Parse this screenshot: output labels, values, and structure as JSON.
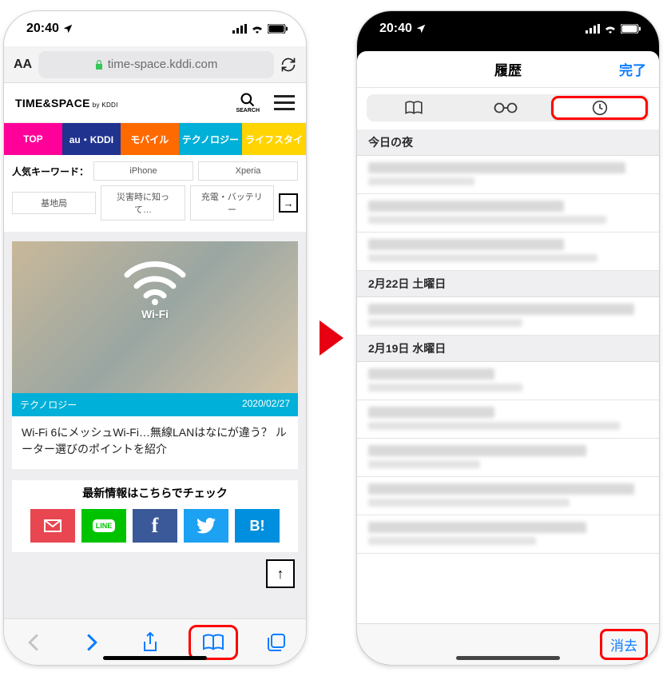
{
  "status": {
    "time": "20:40"
  },
  "left": {
    "url": "time-space.kddi.com",
    "logo_main": "TIME&SPACE",
    "logo_sub": "by KDDI",
    "search_label": "SEARCH",
    "tabs": [
      {
        "label": "TOP",
        "color": "#ff0099"
      },
      {
        "label": "au・KDDI",
        "color": "#20338f"
      },
      {
        "label": "モバイル",
        "color": "#ff6a00"
      },
      {
        "label": "テクノロジー",
        "color": "#00b0d8"
      },
      {
        "label": "ライフスタイ",
        "color": "#ffd400"
      }
    ],
    "kw_label": "人気キーワード：",
    "keywords_row1": [
      "iPhone",
      "Xperia"
    ],
    "keywords_row2": [
      "基地局",
      "災害時に知って…",
      "充電・バッテリー"
    ],
    "card": {
      "wifi_label": "Wi-Fi",
      "category": "テクノロジー",
      "date": "2020/02/27",
      "title": "Wi-Fi 6にメッシュWi-Fi…無線LANはなにが違う？ ルーター選びのポイントを紹介"
    },
    "check_title": "最新情報はこちらでチェック",
    "social": [
      {
        "name": "mail",
        "color": "#e84751",
        "glyph": "✉"
      },
      {
        "name": "line",
        "color": "#00c300",
        "glyph": "LINE"
      },
      {
        "name": "facebook",
        "color": "#3b5998",
        "glyph": "f"
      },
      {
        "name": "twitter",
        "color": "#1da1f2",
        "glyph": "tw"
      },
      {
        "name": "hatena",
        "color": "#008fde",
        "glyph": "B!"
      }
    ]
  },
  "right": {
    "sheet_title": "履歴",
    "done": "完了",
    "sections": [
      "今日の夜",
      "2月22日 土曜日",
      "2月19日 水曜日"
    ],
    "clear": "消去"
  }
}
